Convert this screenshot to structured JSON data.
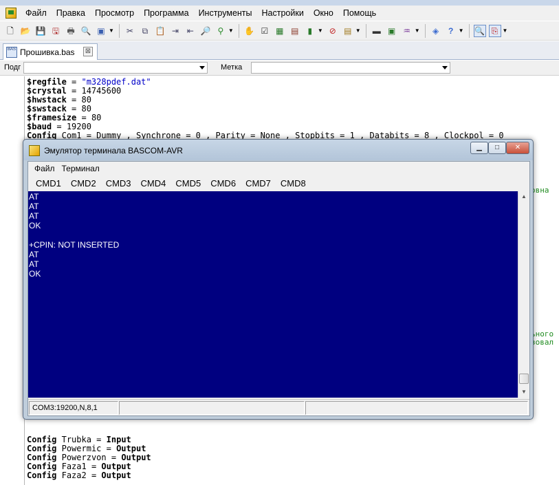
{
  "menu": [
    "Файл",
    "Правка",
    "Просмотр",
    "Программа",
    "Инструменты",
    "Настройки",
    "Окно",
    "Помощь"
  ],
  "tab": {
    "file_label": "Прошивка.bas",
    "file_icon_text": "BAS",
    "close_glyph": "⊠"
  },
  "filter": {
    "sub_label": "Подг",
    "label_label": "Метка",
    "sub_value": "",
    "label_value": ""
  },
  "code_top": [
    {
      "kw": "$regfile",
      "op": " = ",
      "val": "\"m328pdef.dat\"",
      "val_type": "str"
    },
    {
      "kw": "$crystal",
      "op": " = ",
      "val": "14745600",
      "val_type": "num"
    },
    {
      "kw": "$hwstack",
      "op": " = ",
      "val": "80",
      "val_type": "num"
    },
    {
      "kw": "$swstack",
      "op": " = ",
      "val": "80",
      "val_type": "num"
    },
    {
      "kw": "$framesize",
      "op": " = ",
      "val": "80",
      "val_type": "num"
    },
    {
      "kw": "$baud",
      "op": " = ",
      "val": "19200",
      "val_type": "num"
    },
    {
      "kw": "Config",
      "op": " ",
      "val": "Com1 = Dummy , Synchrone = 0 , Parity = None , Stopbits = 1 , Databits = 8 , Clockpol = 0",
      "val_type": "plain"
    }
  ],
  "code_bottom": [
    {
      "kw": "Config",
      "rest": "Trubka",
      "dir": "Input"
    },
    {
      "kw": "Config",
      "rest": "Powermic",
      "dir": "Output"
    },
    {
      "kw": "Config",
      "rest": "Powerzvon",
      "dir": "Output"
    },
    {
      "kw": "Config",
      "rest": "Faza1",
      "dir": "Output"
    },
    {
      "kw": "Config",
      "rest": "Faza2",
      "dir": "Output"
    }
  ],
  "side_fragments": {
    "right1": "овна",
    "right2": "ьного",
    "right3": "зовал"
  },
  "terminal": {
    "title": "Эмулятор терминала BASCOM-AVR",
    "menu": [
      "Файл",
      "Терминал"
    ],
    "cmds": [
      "CMD1",
      "CMD2",
      "CMD3",
      "CMD4",
      "CMD5",
      "CMD6",
      "CMD7",
      "CMD8"
    ],
    "lines": [
      "AT",
      "AT",
      "AT",
      "OK",
      "",
      "+CPIN: NOT INSERTED",
      "AT",
      "AT",
      "OK"
    ],
    "status": [
      "COM3:19200,N,8,1",
      "",
      ""
    ],
    "btn_min": "▁",
    "btn_max": "□",
    "btn_close": "✕"
  },
  "colors": {
    "terminal_bg": "#000080",
    "terminal_fg": "#ffffff",
    "keyword": "#000000",
    "string": "#0000c8",
    "comment": "#1f8b1f"
  }
}
